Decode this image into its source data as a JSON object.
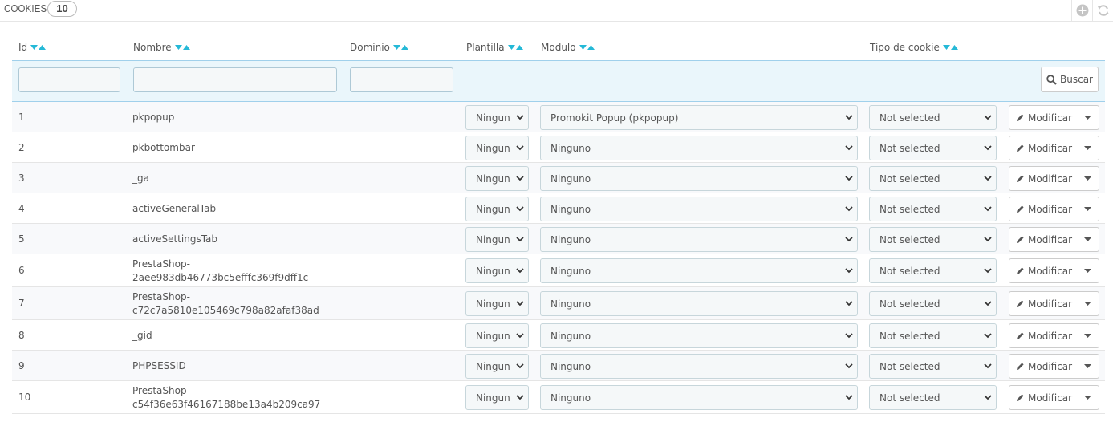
{
  "panel": {
    "title": "COOKIES",
    "count": "10",
    "actions": [
      {
        "icon": "add-circle-icon",
        "title": "add"
      },
      {
        "icon": "refresh-icon",
        "title": "refresh"
      }
    ]
  },
  "columns": [
    {
      "label": "Id"
    },
    {
      "label": "Nombre"
    },
    {
      "label": "Dominio"
    },
    {
      "label": "Plantilla"
    },
    {
      "label": "Modulo"
    },
    {
      "label": "Tipo de cookie"
    }
  ],
  "filters": {
    "id_value": "",
    "name_value": "",
    "domain_value": "",
    "plantilla_placeholder": "--",
    "modulo_placeholder": "--",
    "tipo_placeholder": "--",
    "search_label": "Buscar"
  },
  "rows": [
    {
      "id": "1",
      "name": [
        "pkpopup"
      ],
      "plantilla": "Ningun",
      "modulo": "Promokit Popup (pkpopup)",
      "tipo": "Not selected",
      "action": "Modificar"
    },
    {
      "id": "2",
      "name": [
        "pkbottombar"
      ],
      "plantilla": "Ningun",
      "modulo": "Ninguno",
      "tipo": "Not selected",
      "action": "Modificar"
    },
    {
      "id": "3",
      "name": [
        "_ga"
      ],
      "plantilla": "Ningun",
      "modulo": "Ninguno",
      "tipo": "Not selected",
      "action": "Modificar"
    },
    {
      "id": "4",
      "name": [
        "activeGeneralTab"
      ],
      "plantilla": "Ningun",
      "modulo": "Ninguno",
      "tipo": "Not selected",
      "action": "Modificar"
    },
    {
      "id": "5",
      "name": [
        "activeSettingsTab"
      ],
      "plantilla": "Ningun",
      "modulo": "Ninguno",
      "tipo": "Not selected",
      "action": "Modificar"
    },
    {
      "id": "6",
      "name": [
        "PrestaShop-",
        "2aee983db46773bc5efffc369f9dff1c"
      ],
      "plantilla": "Ningun",
      "modulo": "Ninguno",
      "tipo": "Not selected",
      "action": "Modificar"
    },
    {
      "id": "7",
      "name": [
        "PrestaShop-",
        "c72c7a5810e105469c798a82afaf38ad"
      ],
      "plantilla": "Ningun",
      "modulo": "Ninguno",
      "tipo": "Not selected",
      "action": "Modificar"
    },
    {
      "id": "8",
      "name": [
        "_gid"
      ],
      "plantilla": "Ningun",
      "modulo": "Ninguno",
      "tipo": "Not selected",
      "action": "Modificar"
    },
    {
      "id": "9",
      "name": [
        "PHPSESSID"
      ],
      "plantilla": "Ningun",
      "modulo": "Ninguno",
      "tipo": "Not selected",
      "action": "Modificar"
    },
    {
      "id": "10",
      "name": [
        "PrestaShop-",
        "c54f36e63f46167188be13a4b209ca97"
      ],
      "plantilla": "Ningun",
      "modulo": "Ninguno",
      "tipo": "Not selected",
      "action": "Modificar"
    }
  ],
  "colors": {
    "accent": "#25b9d7",
    "filter_bg": "#eaf6fb"
  }
}
